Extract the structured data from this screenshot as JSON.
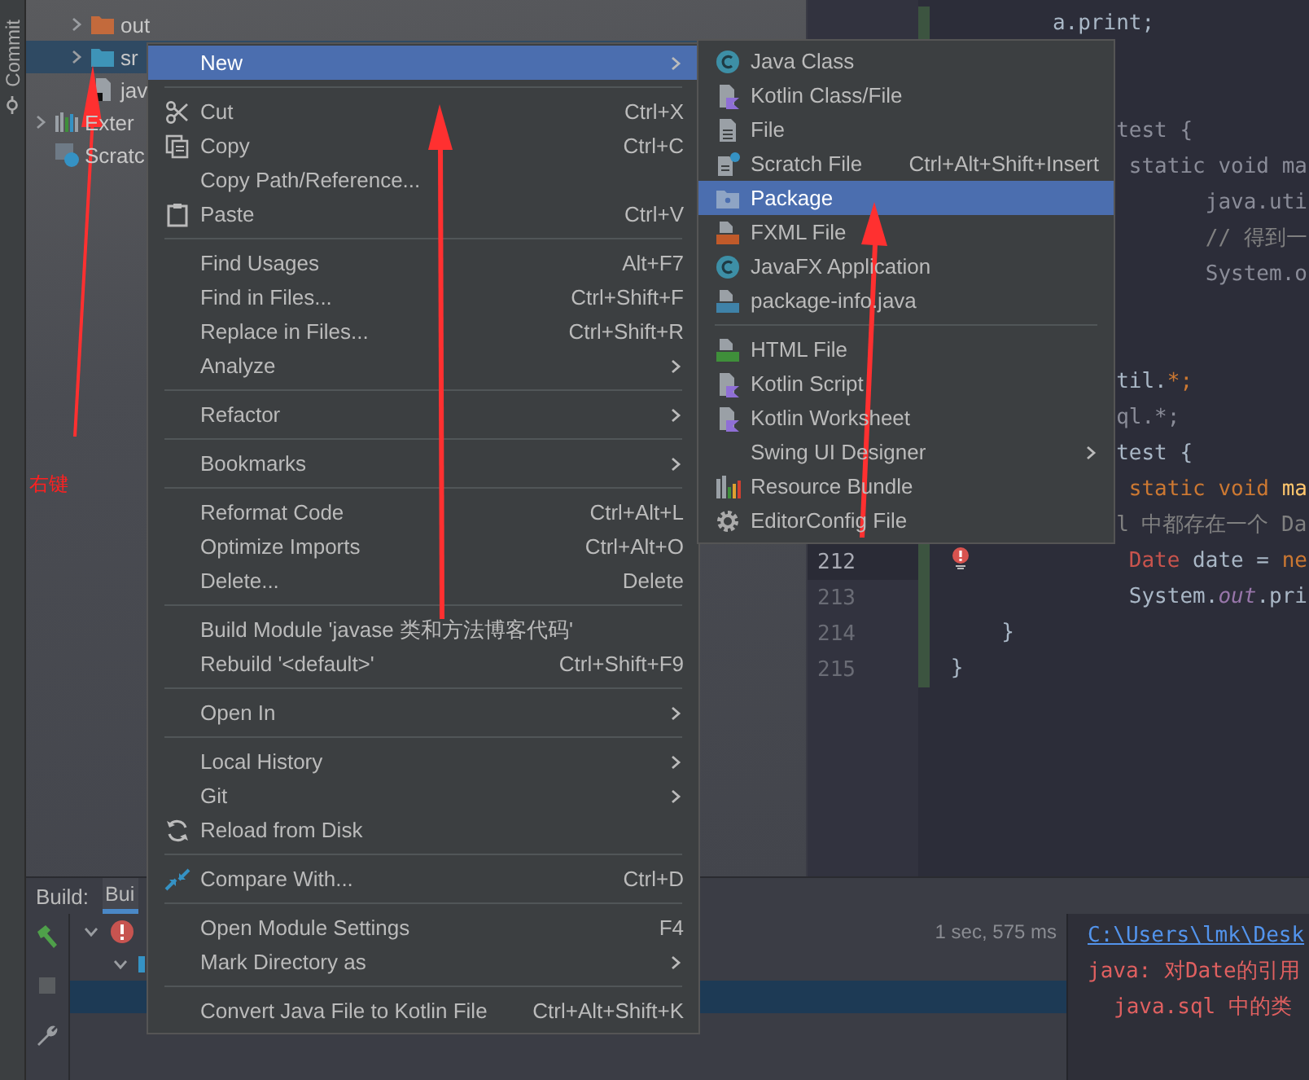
{
  "left_strip": {
    "label": "Commit"
  },
  "project_tree": {
    "module_children": [
      {
        "label": "out",
        "kind": "excluded-folder",
        "expanded": false,
        "selected": false
      },
      {
        "label": "sr",
        "kind": "source-folder",
        "expanded": false,
        "selected": true
      },
      {
        "label": "jav",
        "kind": "java-file",
        "selected": false
      }
    ],
    "items": [
      {
        "label": "Exter",
        "kind": "libraries",
        "expanded": false,
        "selected": false
      },
      {
        "label": "Scratc",
        "kind": "scratches",
        "selected": false
      }
    ]
  },
  "editor": {
    "lines": [
      {
        "kind": "code",
        "segments": [
          {
            "text": "        a.print;",
            "kind": "plain"
          }
        ]
      },
      {
        "kind": "blank"
      },
      {
        "kind": "blank"
      },
      {
        "kind": "code",
        "segments": [
          {
            "text": "             test {",
            "kind": "dim"
          }
        ]
      },
      {
        "kind": "code",
        "segments": [
          {
            "text": "              static void ma",
            "kind": "dim"
          }
        ]
      },
      {
        "kind": "code",
        "segments": [
          {
            "text": "                    java.uti",
            "kind": "dim"
          }
        ]
      },
      {
        "kind": "code",
        "segments": [
          {
            "text": "                    // 得到一",
            "kind": "comment"
          }
        ]
      },
      {
        "kind": "code",
        "segments": [
          {
            "text": "                    System.o",
            "kind": "dim"
          }
        ]
      },
      {
        "kind": "blank"
      },
      {
        "kind": "blank"
      },
      {
        "kind": "code",
        "segments": [
          {
            "text": "             til.",
            "kind": "plain"
          },
          {
            "text": "*;",
            "kind": "keyword"
          }
        ]
      },
      {
        "kind": "code",
        "segments": [
          {
            "text": "             ql.*;",
            "kind": "dim"
          }
        ]
      },
      {
        "kind": "code",
        "segments": [
          {
            "text": "             test {",
            "kind": "plain"
          }
        ]
      },
      {
        "kind": "code",
        "segments": [
          {
            "text": "              static void ",
            "kind": "keyword"
          },
          {
            "text": "ma",
            "kind": "method"
          }
        ]
      },
      {
        "kind": "code",
        "segments": [
          {
            "text": "             l 中都存在一个 Da",
            "kind": "comment"
          }
        ]
      },
      {
        "kind": "code",
        "number": "212",
        "error": true,
        "segments": [
          {
            "text": "              Date",
            "kind": "error"
          },
          {
            "text": " date = ",
            "kind": "plain"
          },
          {
            "text": "ne",
            "kind": "keyword"
          }
        ]
      },
      {
        "kind": "code",
        "number": "213",
        "segments": [
          {
            "text": "              System.",
            "kind": "plain"
          },
          {
            "text": "out",
            "kind": "field"
          },
          {
            "text": ".pri",
            "kind": "plain"
          }
        ]
      },
      {
        "kind": "code",
        "number": "214",
        "segments": [
          {
            "text": "    }",
            "kind": "plain"
          }
        ]
      },
      {
        "kind": "code",
        "number": "215",
        "segments": [
          {
            "text": "}",
            "kind": "plain"
          }
        ]
      }
    ]
  },
  "build_panel": {
    "title": "Build:",
    "tabs": [
      {
        "label": "Bui",
        "selected": true
      }
    ],
    "tree": [
      {
        "kind": "error",
        "expanded": true,
        "selected": false,
        "children": [
          {
            "kind": "module",
            "expanded": true,
            "selected": false,
            "children": [
              {
                "selected": true
              }
            ]
          }
        ]
      }
    ],
    "time": "1 sec, 575 ms",
    "output": [
      {
        "kind": "link",
        "text": "C:\\Users\\lmk\\Desk"
      },
      {
        "kind": "error",
        "text": "java: 对Date的引用"
      },
      {
        "kind": "error-detail",
        "text": "java.sql 中的类"
      }
    ]
  },
  "context_menu": {
    "items": [
      {
        "kind": "item",
        "label": "New",
        "submenu": true,
        "selected": true
      },
      {
        "kind": "separator"
      },
      {
        "kind": "item",
        "label": "Cut",
        "shortcut": "Ctrl+X",
        "selected": false
      },
      {
        "kind": "item",
        "label": "Copy",
        "shortcut": "Ctrl+C",
        "selected": false
      },
      {
        "kind": "item",
        "label": "Copy Path/Reference...",
        "selected": false
      },
      {
        "kind": "item",
        "label": "Paste",
        "shortcut": "Ctrl+V",
        "selected": false
      },
      {
        "kind": "separator"
      },
      {
        "kind": "item",
        "label": "Find Usages",
        "shortcut": "Alt+F7",
        "selected": false
      },
      {
        "kind": "item",
        "label": "Find in Files...",
        "shortcut": "Ctrl+Shift+F",
        "selected": false
      },
      {
        "kind": "item",
        "label": "Replace in Files...",
        "shortcut": "Ctrl+Shift+R",
        "selected": false
      },
      {
        "kind": "item",
        "label": "Analyze",
        "submenu": true,
        "selected": false
      },
      {
        "kind": "separator"
      },
      {
        "kind": "item",
        "label": "Refactor",
        "submenu": true,
        "selected": false
      },
      {
        "kind": "separator"
      },
      {
        "kind": "item",
        "label": "Bookmarks",
        "submenu": true,
        "selected": false
      },
      {
        "kind": "separator"
      },
      {
        "kind": "item",
        "label": "Reformat Code",
        "shortcut": "Ctrl+Alt+L",
        "selected": false
      },
      {
        "kind": "item",
        "label": "Optimize Imports",
        "shortcut": "Ctrl+Alt+O",
        "selected": false
      },
      {
        "kind": "item",
        "label": "Delete...",
        "shortcut": "Delete",
        "selected": false
      },
      {
        "kind": "separator"
      },
      {
        "kind": "item",
        "label": "Build Module 'javase 类和方法博客代码'",
        "selected": false
      },
      {
        "kind": "item",
        "label": "Rebuild '<default>'",
        "shortcut": "Ctrl+Shift+F9",
        "selected": false
      },
      {
        "kind": "separator"
      },
      {
        "kind": "item",
        "label": "Open In",
        "submenu": true,
        "selected": false
      },
      {
        "kind": "separator"
      },
      {
        "kind": "item",
        "label": "Local History",
        "submenu": true,
        "selected": false
      },
      {
        "kind": "item",
        "label": "Git",
        "submenu": true,
        "selected": false
      },
      {
        "kind": "item",
        "label": "Reload from Disk",
        "selected": false
      },
      {
        "kind": "separator"
      },
      {
        "kind": "item",
        "label": "Compare With...",
        "shortcut": "Ctrl+D",
        "selected": false
      },
      {
        "kind": "separator"
      },
      {
        "kind": "item",
        "label": "Open Module Settings",
        "shortcut": "F4",
        "selected": false
      },
      {
        "kind": "item",
        "label": "Mark Directory as",
        "submenu": true,
        "selected": false
      },
      {
        "kind": "separator"
      },
      {
        "kind": "item",
        "label": "Convert Java File to Kotlin File",
        "shortcut": "Ctrl+Alt+Shift+K",
        "selected": false
      }
    ]
  },
  "new_submenu": {
    "items": [
      {
        "kind": "item",
        "label": "Java Class",
        "selected": false
      },
      {
        "kind": "item",
        "label": "Kotlin Class/File",
        "selected": false
      },
      {
        "kind": "item",
        "label": "File",
        "selected": false
      },
      {
        "kind": "item",
        "label": "Scratch File",
        "shortcut": "Ctrl+Alt+Shift+Insert",
        "selected": false
      },
      {
        "kind": "item",
        "label": "Package",
        "selected": true
      },
      {
        "kind": "item",
        "label": "FXML File",
        "selected": false
      },
      {
        "kind": "item",
        "label": "JavaFX Application",
        "selected": false
      },
      {
        "kind": "item",
        "label": "package-info.java",
        "selected": false
      },
      {
        "kind": "separator"
      },
      {
        "kind": "item",
        "label": "HTML File",
        "selected": false
      },
      {
        "kind": "item",
        "label": "Kotlin Script",
        "selected": false
      },
      {
        "kind": "item",
        "label": "Kotlin Worksheet",
        "selected": false
      },
      {
        "kind": "item",
        "label": "Swing UI Designer",
        "submenu": true,
        "selected": false
      },
      {
        "kind": "item",
        "label": "Resource Bundle",
        "selected": false
      },
      {
        "kind": "item",
        "label": "EditorConfig File",
        "selected": false
      }
    ]
  },
  "annotation": {
    "label": "右键"
  }
}
